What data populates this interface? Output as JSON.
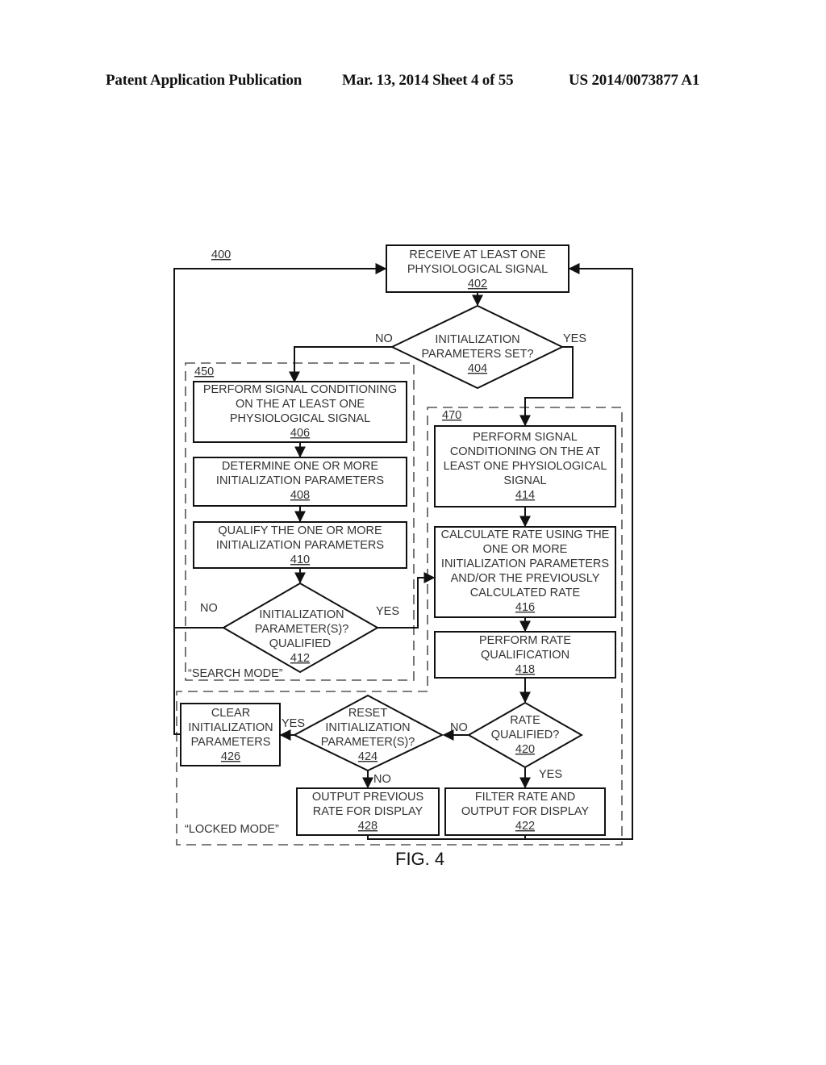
{
  "header": {
    "publication": "Patent Application Publication",
    "date_sheet": "Mar. 13, 2014  Sheet 4 of 55",
    "number": "US 2014/0073877 A1"
  },
  "figure": {
    "ref": "400",
    "caption": "FIG. 4",
    "regions": {
      "search": {
        "ref": "450",
        "label": "“SEARCH MODE”"
      },
      "locked_ref": "470",
      "locked_label": "“LOCKED MODE”"
    },
    "nodes": {
      "n402": {
        "lines": [
          "RECEIVE AT LEAST ONE",
          "PHYSIOLOGICAL SIGNAL"
        ],
        "ref": "402"
      },
      "n404": {
        "lines": [
          "INITIALIZATION",
          "PARAMETERS SET?"
        ],
        "ref": "404"
      },
      "n406": {
        "lines": [
          "PERFORM SIGNAL CONDITIONING",
          "ON THE AT LEAST ONE",
          "PHYSIOLOGICAL SIGNAL"
        ],
        "ref": "406"
      },
      "n408": {
        "lines": [
          "DETERMINE ONE OR MORE",
          "INITIALIZATION PARAMETERS"
        ],
        "ref": "408"
      },
      "n410": {
        "lines": [
          "QUALIFY THE ONE OR MORE",
          "INITIALIZATION PARAMETERS"
        ],
        "ref": "410"
      },
      "n412": {
        "lines": [
          "INITIALIZATION",
          "PARAMETER(S)?",
          "QUALIFIED"
        ],
        "ref": "412"
      },
      "n414": {
        "lines": [
          "PERFORM SIGNAL",
          "CONDITIONING ON THE AT",
          "LEAST ONE PHYSIOLOGICAL",
          "SIGNAL"
        ],
        "ref": "414"
      },
      "n416": {
        "lines": [
          "CALCULATE RATE USING THE",
          "ONE OR MORE",
          "INITIALIZATION PARAMETERS",
          "AND/OR THE PREVIOUSLY",
          "CALCULATED RATE"
        ],
        "ref": "416"
      },
      "n418": {
        "lines": [
          "PERFORM RATE",
          "QUALIFICATION"
        ],
        "ref": "418"
      },
      "n420": {
        "lines": [
          "RATE",
          "QUALIFIED?"
        ],
        "ref": "420"
      },
      "n422": {
        "lines": [
          "FILTER RATE AND",
          "OUTPUT FOR DISPLAY"
        ],
        "ref": "422"
      },
      "n424": {
        "lines": [
          "RESET",
          "INITIALIZATION",
          "PARAMETER(S)?"
        ],
        "ref": "424"
      },
      "n426": {
        "lines": [
          "CLEAR",
          "INITIALIZATION",
          "PARAMETERS"
        ],
        "ref": "426"
      },
      "n428": {
        "lines": [
          "OUTPUT PREVIOUS",
          "RATE FOR DISPLAY"
        ],
        "ref": "428"
      }
    },
    "edge_labels": {
      "e404_no": "NO",
      "e404_yes": "YES",
      "e412_no": "NO",
      "e412_yes": "YES",
      "e420_no": "NO",
      "e420_yes": "YES",
      "e424_yes": "YES",
      "e424_no": "NO"
    }
  }
}
